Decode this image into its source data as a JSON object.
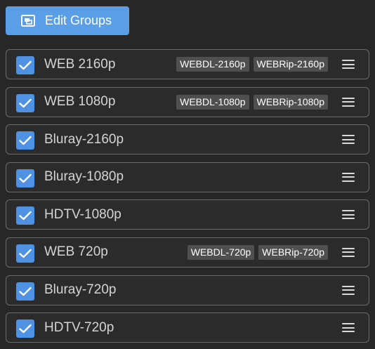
{
  "toolbar": {
    "edit_groups_label": "Edit Groups",
    "edit_groups_icon": "edit-groups-icon"
  },
  "colors": {
    "accent": "#5b9ee8",
    "checkbox": "#4f92e3",
    "background": "#272727",
    "tag_bg": "#4f4f4f"
  },
  "qualities": [
    {
      "label": "WEB 2160p",
      "checked": true,
      "tags": [
        "WEBDL-2160p",
        "WEBRip-2160p"
      ]
    },
    {
      "label": "WEB 1080p",
      "checked": true,
      "tags": [
        "WEBDL-1080p",
        "WEBRip-1080p"
      ]
    },
    {
      "label": "Bluray-2160p",
      "checked": true,
      "tags": []
    },
    {
      "label": "Bluray-1080p",
      "checked": true,
      "tags": []
    },
    {
      "label": "HDTV-1080p",
      "checked": true,
      "tags": []
    },
    {
      "label": "WEB 720p",
      "checked": true,
      "tags": [
        "WEBDL-720p",
        "WEBRip-720p"
      ]
    },
    {
      "label": "Bluray-720p",
      "checked": true,
      "tags": []
    },
    {
      "label": "HDTV-720p",
      "checked": true,
      "tags": []
    }
  ]
}
